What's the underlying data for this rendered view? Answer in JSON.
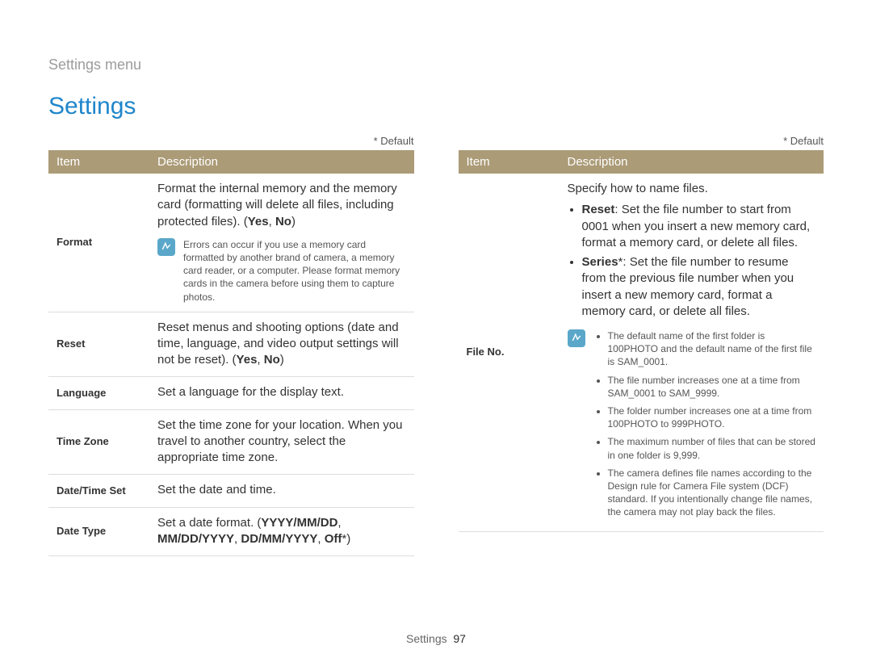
{
  "breadcrumb": "Settings menu",
  "title": "Settings",
  "default_legend": "* Default",
  "table_headers": {
    "item": "Item",
    "desc": "Description"
  },
  "left": {
    "format": {
      "item": "Format",
      "desc_pre": "Format the internal memory and the memory card (formatting will delete all files, including protected files). (",
      "opt": "Yes",
      "sep": ", ",
      "opt2": "No",
      "desc_post": ")",
      "note": "Errors can occur if you use a memory card formatted by another brand of camera, a memory card reader, or a computer. Please format memory cards in the camera before using them to capture photos."
    },
    "reset": {
      "item": "Reset",
      "desc_pre": "Reset menus and shooting options (date and time, language, and video output settings will not be reset). (",
      "opt": "Yes",
      "sep": ", ",
      "opt2": "No",
      "desc_post": ")"
    },
    "language": {
      "item": "Language",
      "desc": "Set a language for the display text."
    },
    "timezone": {
      "item": "Time Zone",
      "desc": "Set the time zone for your location. When you travel to another country, select the appropriate time zone."
    },
    "datetimeset": {
      "item": "Date/Time Set",
      "desc": "Set the date and time."
    },
    "datetype": {
      "item": "Date Type",
      "desc_pre": "Set a date format. (",
      "opts": "YYYY/MM/DD",
      "sep1": ", ",
      "opts2": "MM/DD/YYYY",
      "sep2": ", ",
      "opts3": "DD/MM/YYYY",
      "sep3": ", ",
      "opts4": "Off",
      "star": "*",
      "desc_post": ")"
    }
  },
  "right": {
    "fileno": {
      "item": "File No.",
      "intro": "Specify how to name files.",
      "bullet1_label": "Reset",
      "bullet1_text": ": Set the file number to start from 0001 when you insert a new memory card, format a memory card, or delete all files.",
      "bullet2_label": "Series",
      "bullet2_star": "*",
      "bullet2_text": ": Set the file number to resume from the previous file number when you insert a new memory card, format a memory card, or delete all files.",
      "notes": [
        "The default name of the first folder is 100PHOTO and the default name of the first file is SAM_0001.",
        "The file number increases one at a time from SAM_0001 to SAM_9999.",
        "The folder number increases one at a time from 100PHOTO to 999PHOTO.",
        "The maximum number of files that can be stored in one folder is 9,999.",
        "The camera defines file names according to the Design rule for Camera File system (DCF) standard. If you intentionally change file names, the camera may not play back the files."
      ]
    }
  },
  "footer": {
    "section": "Settings",
    "page": "97"
  }
}
